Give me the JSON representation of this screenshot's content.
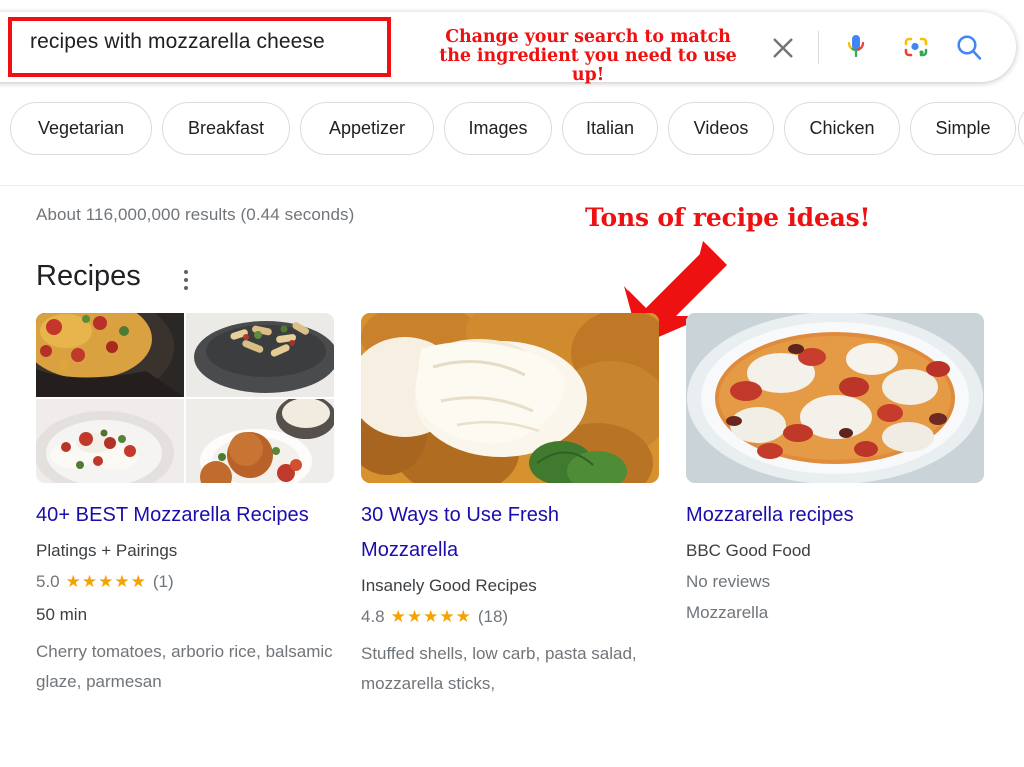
{
  "search": {
    "query": "recipes with mozzarella cheese",
    "placeholder": "Search",
    "annotation_line1": "Change your search to match",
    "annotation_line2": "the ingredient you need to use up!",
    "clear_icon": "close-icon",
    "mic_icon": "microphone-icon",
    "lens_icon": "google-lens-camera-icon",
    "search_icon": "search-icon"
  },
  "filter_chips": [
    {
      "label": "Vegetarian"
    },
    {
      "label": "Breakfast"
    },
    {
      "label": "Appetizer"
    },
    {
      "label": "Images"
    },
    {
      "label": "Italian"
    },
    {
      "label": "Videos"
    },
    {
      "label": "Chicken"
    },
    {
      "label": "Simple"
    },
    {
      "label": ""
    }
  ],
  "results": {
    "stats": "About 116,000,000 results (0.44 seconds)",
    "annotation": "Tons of recipe ideas!",
    "section_title": "Recipes",
    "menu_icon": "more-options-kebab-icon"
  },
  "cards": [
    {
      "title": "40+ BEST Mozzarella Recipes",
      "source": "Platings + Pairings",
      "rating": "5.0",
      "stars": "★★★★★",
      "review_count": "(1)",
      "time": "50 min",
      "description": "Cherry tomatoes, arborio rice, balsamic glaze, parmesan",
      "image_alt": "mozzarella-recipes-collage"
    },
    {
      "title": "30 Ways to Use Fresh Mozzarella",
      "source": "Insanely Good Recipes",
      "rating": "4.8",
      "stars": "★★★★★",
      "review_count": "(18)",
      "time": "",
      "description": "Stuffed shells, low carb, pasta salad, mozzarella sticks,",
      "image_alt": "fried-mozzarella-sticks-photo"
    },
    {
      "title": "Mozzarella recipes",
      "source": "BBC Good Food",
      "rating": "",
      "stars": "",
      "review_count": "",
      "no_reviews": "No reviews",
      "time": "",
      "description": "Mozzarella",
      "image_alt": "tomato-mozzarella-bake-photo"
    }
  ],
  "colors": {
    "link": "#1a0dab",
    "annotation_red": "#ee1111",
    "star_amber": "#f5a302",
    "text_gray": "#70757a"
  }
}
